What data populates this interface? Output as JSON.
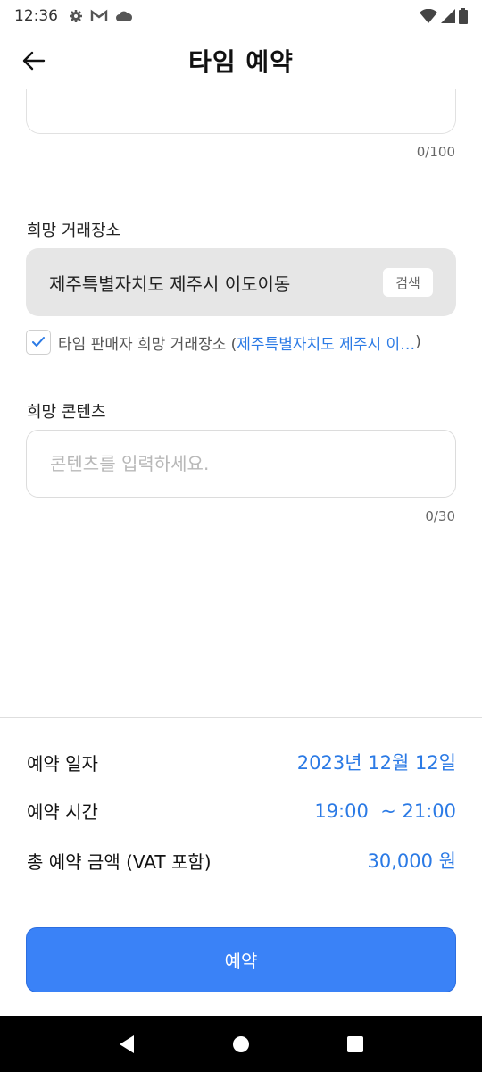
{
  "status_bar": {
    "time": "12:36",
    "icons_left": [
      "gear-icon",
      "gmail-icon",
      "cloud-icon"
    ],
    "icons_right": [
      "wifi-icon",
      "signal-icon",
      "battery-icon"
    ]
  },
  "app_bar": {
    "title": "타임 예약",
    "back_icon": "arrow-left-icon"
  },
  "top_field": {
    "counter": "0/100"
  },
  "location": {
    "label": "희망 거래장소",
    "value": "제주특별자치도 제주시 이도이동",
    "search_label": "검색"
  },
  "seller_location": {
    "checked": true,
    "prefix": "타임 판매자 희망 거래장소 (",
    "link": "제주특별자치도 제주시 이…",
    "suffix": ")"
  },
  "contents": {
    "label": "희망 콘텐츠",
    "value": "",
    "placeholder": "콘텐츠를 입력하세요.",
    "counter": "0/30"
  },
  "summary": {
    "date_label": "예약 일자",
    "date_value": "2023년 12월 12일",
    "time_label": "예약 시간",
    "time_value": "19:00  ~ 21:00",
    "amount_label": "총 예약 금액 (VAT 포함)",
    "amount_value": "30,000 원"
  },
  "reserve_button": {
    "label": "예약"
  },
  "colors": {
    "accent": "#3a82f7",
    "link": "#2b7ae5",
    "field_bg": "#e6e6e6"
  }
}
